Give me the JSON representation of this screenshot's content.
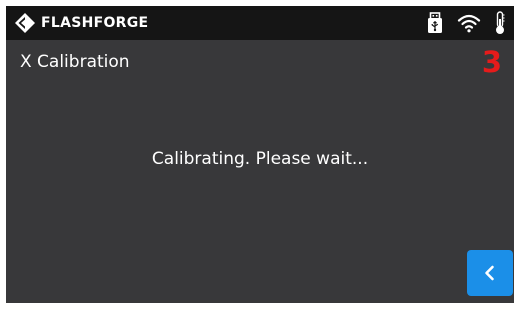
{
  "status_bar": {
    "brand_name": "FLASHFORGE",
    "logo_icon": "flashforge-logo-icon",
    "icons": [
      "usb-drive-icon",
      "wifi-icon",
      "thermometer-icon"
    ]
  },
  "page": {
    "title": "X Calibration",
    "countdown": "3",
    "message": "Calibrating. Please wait..."
  },
  "buttons": {
    "back_icon": "chevron-left-icon"
  },
  "colors": {
    "background": "#38383a",
    "status_bar": "#151515",
    "countdown": "#e51b1b",
    "accent": "#1b8fe8",
    "text": "#ffffff"
  }
}
